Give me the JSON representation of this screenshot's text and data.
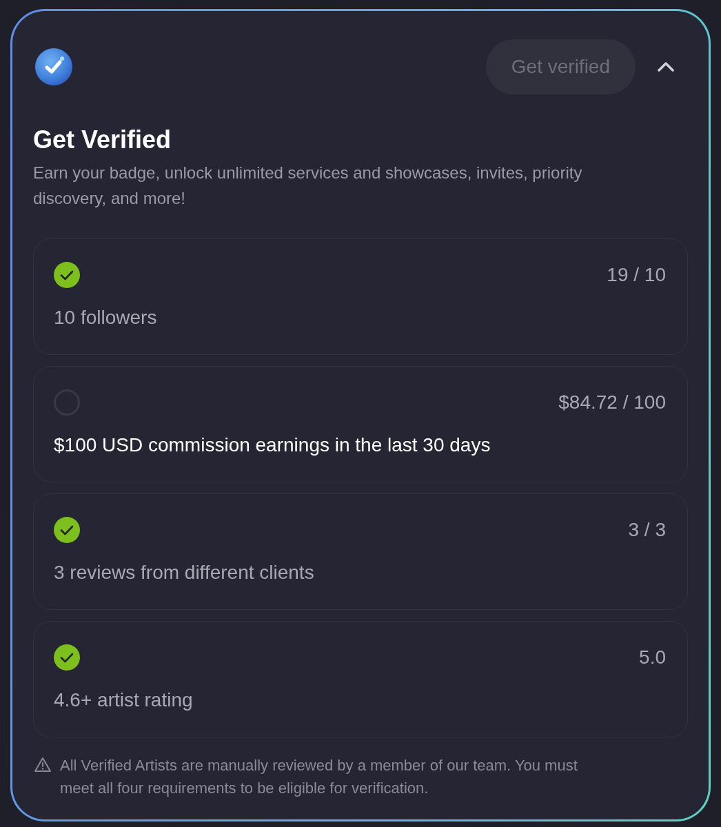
{
  "header": {
    "button": {
      "label": "Get verified",
      "disabled": true
    },
    "expanded": true
  },
  "title": "Get Verified",
  "description": "Earn your badge, unlock unlimited services and showcases, invites, priority discovery, and more!",
  "requirements": [
    {
      "label": "10 followers",
      "progress": "19 / 10",
      "met": true
    },
    {
      "label": "$100 USD commission earnings in the last 30 days",
      "progress": "$84.72 / 100",
      "met": false
    },
    {
      "label": "3 reviews from different clients",
      "progress": "3 / 3",
      "met": true
    },
    {
      "label": "4.6+ artist rating",
      "progress": "5.0",
      "met": true
    }
  ],
  "footer_note": "All Verified Artists are manually reviewed by a member of our team. You must meet all four requirements to be eligible for verification."
}
